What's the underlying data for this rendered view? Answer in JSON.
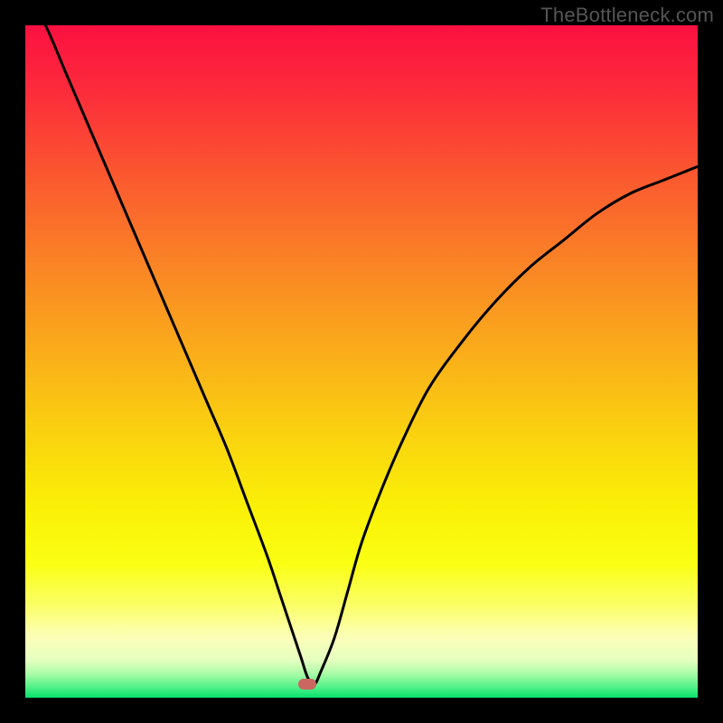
{
  "watermark": {
    "text": "TheBottleneck.com"
  },
  "colors": {
    "bg": "#000000",
    "curve": "#000000",
    "marker": "#cb6660",
    "gradient_stops": [
      {
        "pos": 0.0,
        "color": "#fc1041"
      },
      {
        "pos": 0.1,
        "color": "#fc2c3b"
      },
      {
        "pos": 0.22,
        "color": "#fb5730"
      },
      {
        "pos": 0.35,
        "color": "#fa8226"
      },
      {
        "pos": 0.48,
        "color": "#faab1b"
      },
      {
        "pos": 0.6,
        "color": "#fad010"
      },
      {
        "pos": 0.72,
        "color": "#faf107"
      },
      {
        "pos": 0.8,
        "color": "#faff13"
      },
      {
        "pos": 0.86,
        "color": "#fbff63"
      },
      {
        "pos": 0.91,
        "color": "#fcffb8"
      },
      {
        "pos": 0.945,
        "color": "#e4ffc0"
      },
      {
        "pos": 0.965,
        "color": "#a7fca6"
      },
      {
        "pos": 0.985,
        "color": "#4ef087"
      },
      {
        "pos": 1.0,
        "color": "#05e26c"
      }
    ]
  },
  "chart_data": {
    "type": "line",
    "title": "",
    "xlabel": "",
    "ylabel": "",
    "xlim": [
      0,
      100
    ],
    "ylim": [
      0,
      100
    ],
    "grid": false,
    "legend": false,
    "marker": {
      "x": 42,
      "y": 2
    },
    "series": [
      {
        "name": "bottleneck-curve",
        "x": [
          0,
          3,
          6,
          9,
          12,
          15,
          18,
          21,
          24,
          27,
          30,
          33,
          36,
          38,
          40,
          41,
          42,
          43,
          44,
          46,
          48,
          50,
          53,
          56,
          60,
          65,
          70,
          75,
          80,
          85,
          90,
          95,
          100
        ],
        "y": [
          105,
          100,
          93,
          86,
          79,
          72,
          65,
          58,
          51,
          44,
          37,
          29,
          21,
          15,
          9,
          6,
          3,
          2,
          4,
          9,
          16,
          23,
          31,
          38,
          46,
          53,
          59,
          64,
          68,
          72,
          75,
          77,
          79
        ]
      }
    ]
  }
}
